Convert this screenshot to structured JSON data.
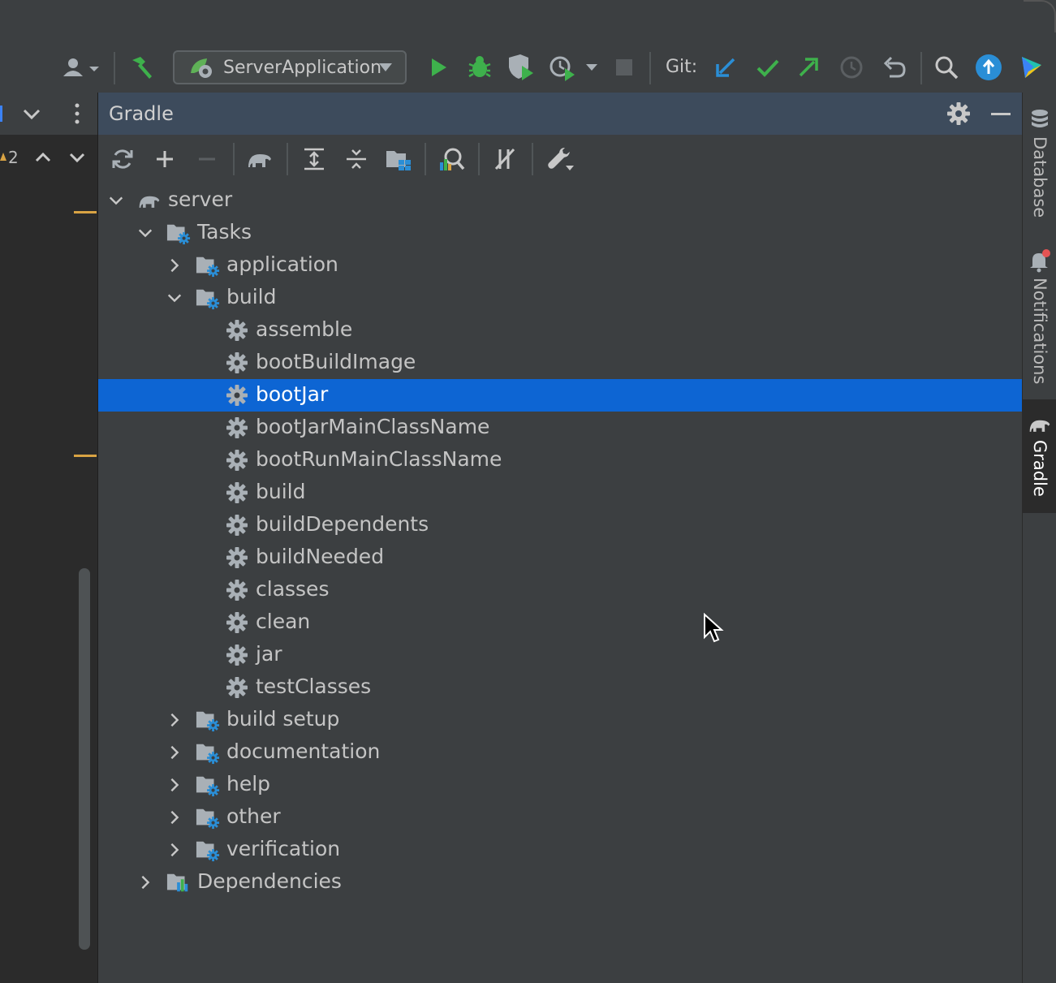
{
  "toolbar": {
    "run_config": "ServerApplication",
    "git_label": "Git:"
  },
  "left_gutter": {
    "warning_count": "2"
  },
  "panel": {
    "title": "Gradle"
  },
  "tree": {
    "root": "server",
    "tasks": "Tasks",
    "application": "application",
    "build_group": "build",
    "build_tasks": [
      "assemble",
      "bootBuildImage",
      "bootJar",
      "bootJarMainClassName",
      "bootRunMainClassName",
      "build",
      "buildDependents",
      "buildNeeded",
      "classes",
      "clean",
      "jar",
      "testClasses"
    ],
    "groups_after": [
      "build setup",
      "documentation",
      "help",
      "other",
      "verification"
    ],
    "dependencies": "Dependencies",
    "selected": "bootJar"
  },
  "right_tabs": {
    "database": "Database",
    "notifications": "Notifications",
    "gradle": "Gradle"
  },
  "colors": {
    "selection": "#0d65d3",
    "panel_header": "#3d4b5c",
    "run_green": "#3eb14c",
    "git_blue": "#2a8ed6"
  }
}
